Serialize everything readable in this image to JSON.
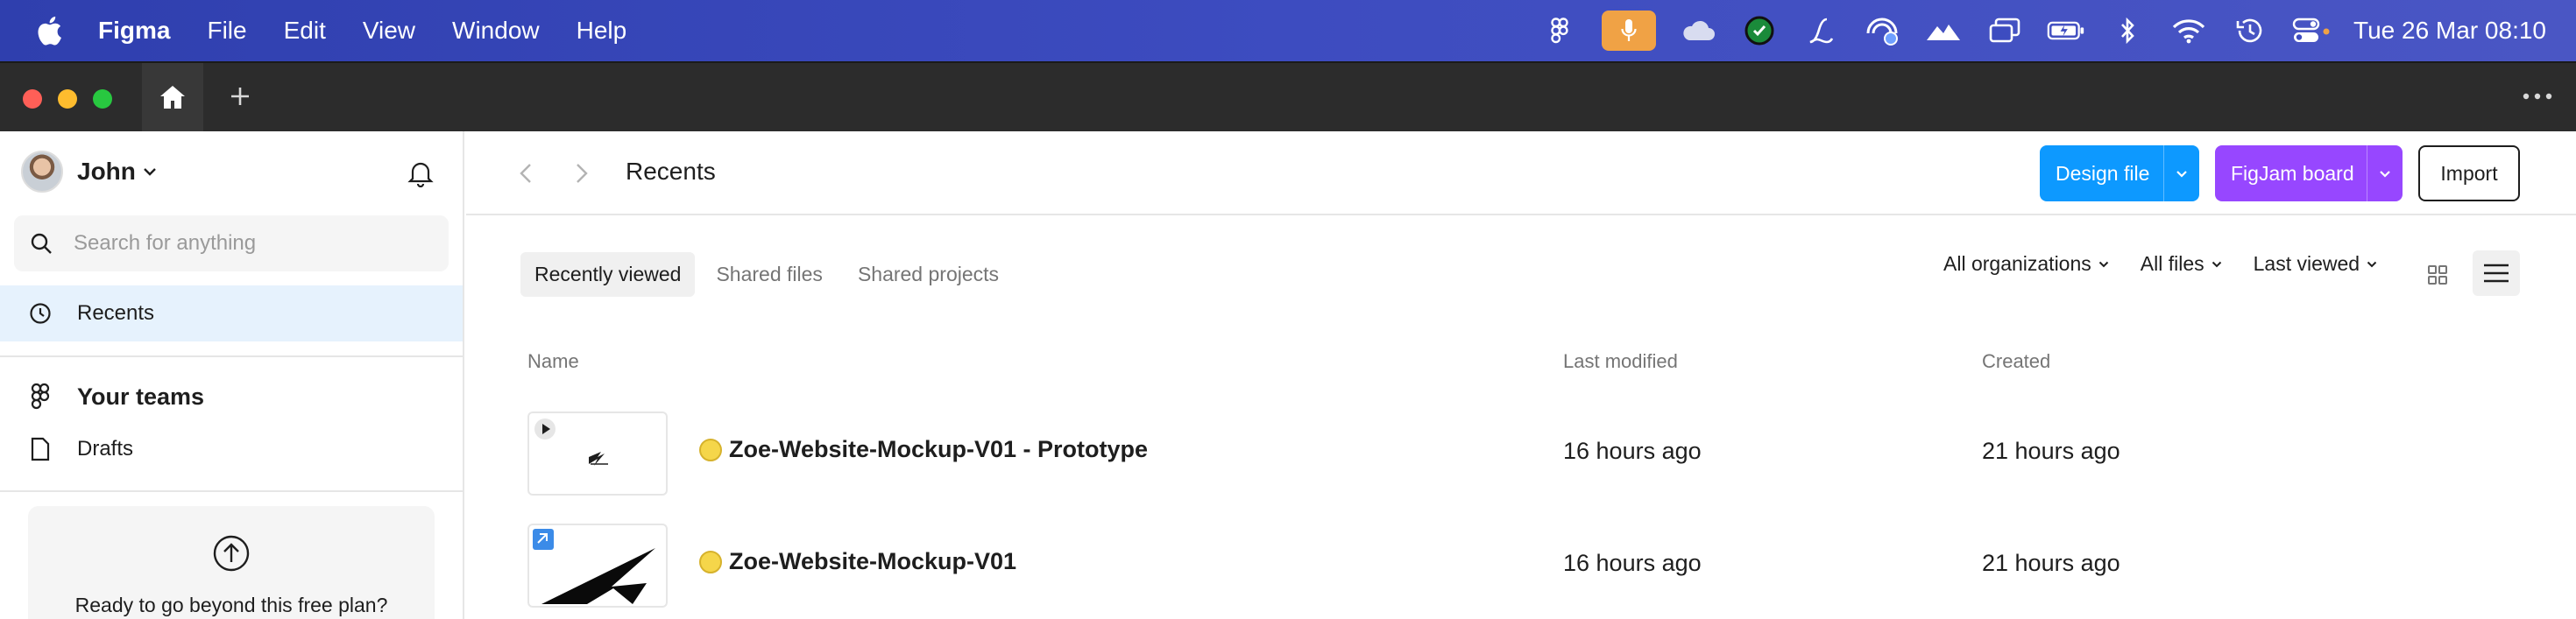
{
  "menubar": {
    "app_name": "Figma",
    "menus": [
      "File",
      "Edit",
      "View",
      "Window",
      "Help"
    ],
    "clock": "Tue 26 Mar  08:10",
    "status_icons": [
      "figma-icon",
      "microphone-icon",
      "cloud-icon",
      "timer-icon",
      "script-l-icon",
      "network-monitor-icon",
      "mountain-icon",
      "screen-mirror-icon",
      "battery-icon",
      "bluetooth-icon",
      "wifi-icon",
      "time-machine-icon",
      "control-center-icon"
    ]
  },
  "sidebar": {
    "user_name": "John",
    "search_placeholder": "Search for anything",
    "recents_label": "Recents",
    "teams_label": "Your teams",
    "drafts_label": "Drafts",
    "upgrade_text": "Ready to go beyond this free plan?"
  },
  "header": {
    "title": "Recents",
    "design_file_label": "Design file",
    "figjam_label": "FigJam board",
    "import_label": "Import"
  },
  "tabs": [
    {
      "label": "Recently viewed",
      "active": true
    },
    {
      "label": "Shared files",
      "active": false
    },
    {
      "label": "Shared projects",
      "active": false
    }
  ],
  "filters": {
    "organizations": "All organizations",
    "files": "All files",
    "sort": "Last viewed"
  },
  "table": {
    "columns": {
      "name": "Name",
      "modified": "Last modified",
      "created": "Created"
    },
    "rows": [
      {
        "name": "Zoe-Website-Mockup-V01 - Prototype",
        "modified": "16 hours ago",
        "created": "21 hours ago",
        "kind": "prototype"
      },
      {
        "name": "Zoe-Website-Mockup-V01",
        "modified": "16 hours ago",
        "created": "21 hours ago",
        "kind": "design"
      }
    ]
  },
  "colors": {
    "design_button": "#0d99ff",
    "figjam_button": "#9747ff",
    "selected_nav": "#e6f2fd",
    "status_dot": "#f5d64a"
  }
}
